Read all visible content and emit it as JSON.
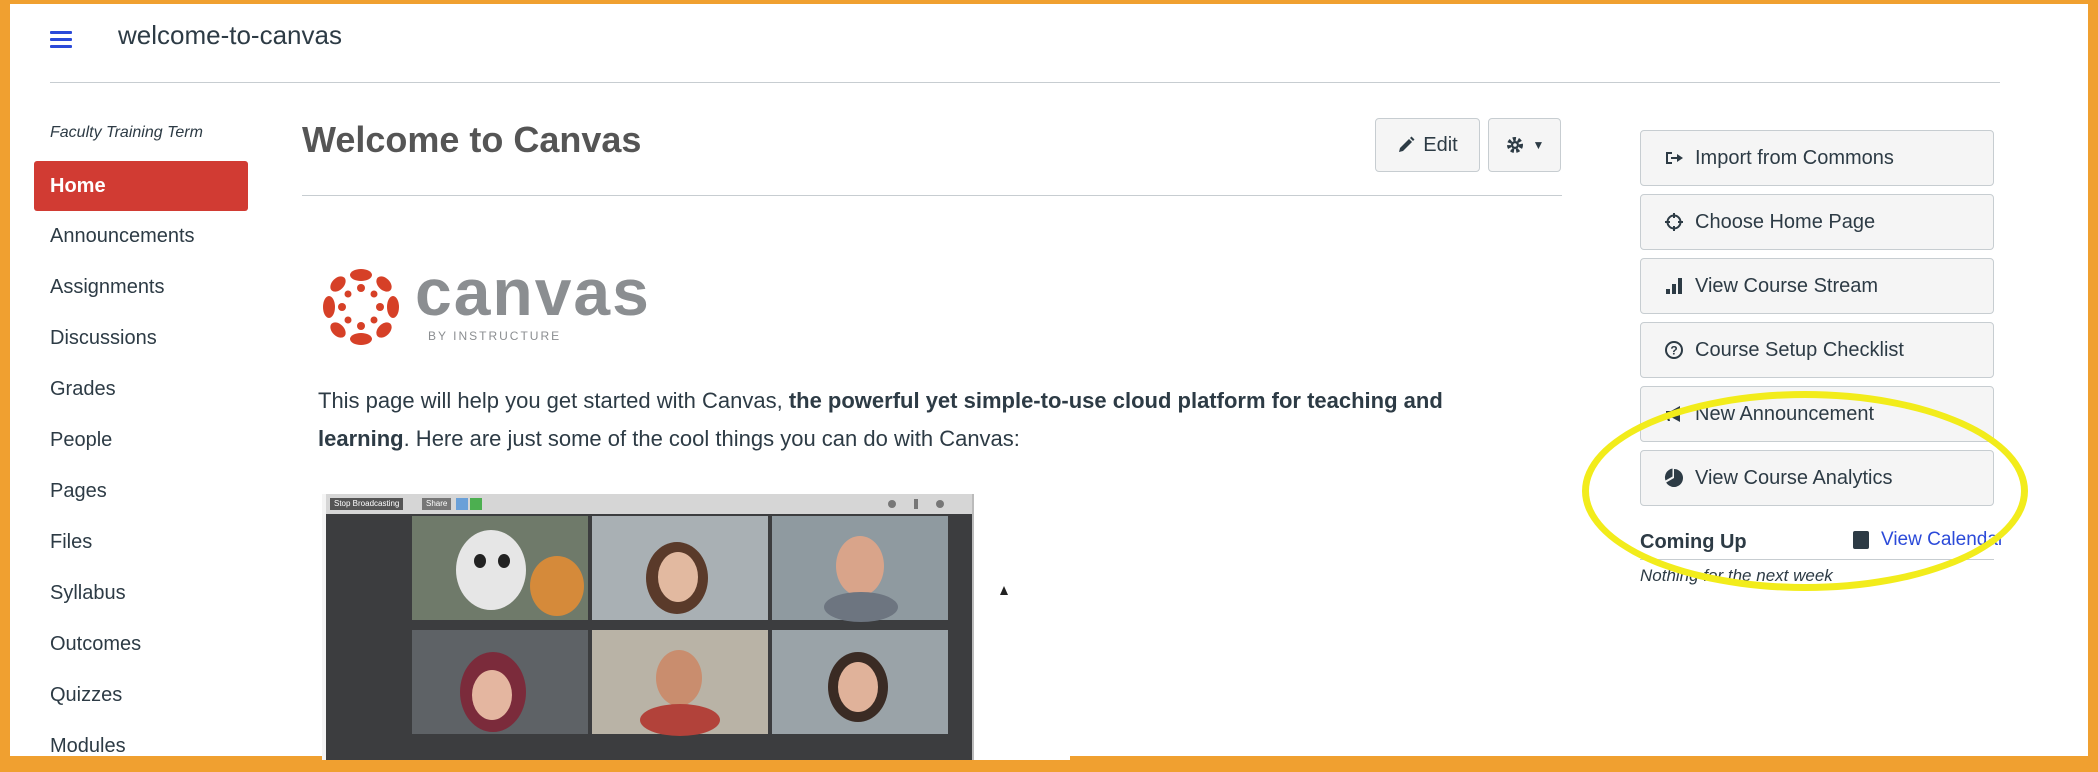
{
  "header": {
    "breadcrumb": "welcome-to-canvas"
  },
  "nav": {
    "term": "Faculty Training Term",
    "items": [
      {
        "label": "Home"
      },
      {
        "label": "Announcements"
      },
      {
        "label": "Assignments"
      },
      {
        "label": "Discussions"
      },
      {
        "label": "Grades"
      },
      {
        "label": "People"
      },
      {
        "label": "Pages"
      },
      {
        "label": "Files"
      },
      {
        "label": "Syllabus"
      },
      {
        "label": "Outcomes"
      },
      {
        "label": "Quizzes"
      },
      {
        "label": "Modules"
      }
    ]
  },
  "main": {
    "title": "Welcome to Canvas",
    "edit_label": "Edit",
    "logo": {
      "word": "canvas",
      "sub": "BY INSTRUCTURE"
    },
    "intro_plain_1": "This page will help you get started with Canvas, ",
    "intro_bold": "the powerful yet simple-to-use cloud platform for teaching and learning",
    "intro_plain_2": ". Here are just some of the cool things you can do with Canvas:",
    "video": {
      "stop_label": "Stop Broadcasting",
      "share_label": "Share"
    }
  },
  "sidebar": {
    "buttons": [
      {
        "label": "Import from Commons",
        "icon": "import-icon"
      },
      {
        "label": "Choose Home Page",
        "icon": "target-icon"
      },
      {
        "label": "View Course Stream",
        "icon": "bar-chart-icon"
      },
      {
        "label": "Course Setup Checklist",
        "icon": "question-icon"
      },
      {
        "label": "New Announcement",
        "icon": "megaphone-icon"
      },
      {
        "label": "View Course Analytics",
        "icon": "pie-chart-icon"
      }
    ],
    "coming_up": "Coming Up",
    "view_calendar": "View Calendar",
    "nothing": "Nothing for the next week"
  },
  "colors": {
    "accent_red": "#d13b33",
    "link_blue": "#2b4ad9",
    "highlight_yellow": "#f2ec1b"
  }
}
